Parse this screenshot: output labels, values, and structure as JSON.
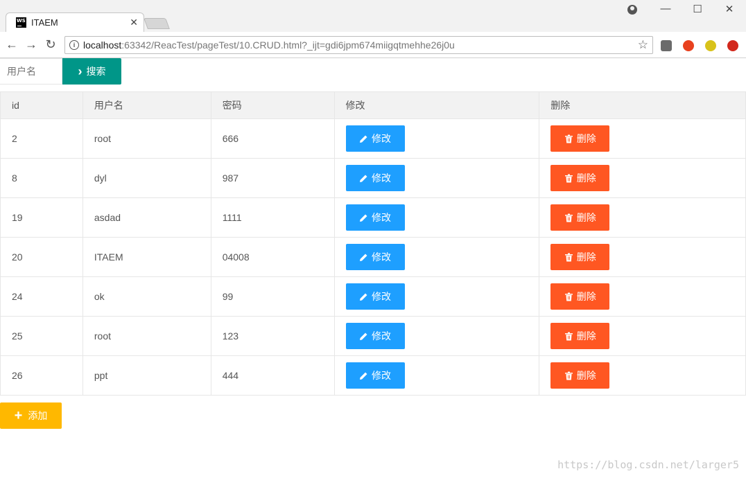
{
  "browser": {
    "tab_title": "ITAEM",
    "tab_close": "✕",
    "logo_text": "WS",
    "url_host": "localhost",
    "url_path": ":63342/ReacTest/pageTest/10.CRUD.html?_ijt=gdi6jpm674miigqtmehhe26j0u",
    "icons": [
      "back-icon",
      "forward-icon",
      "reload-icon",
      "info-icon",
      "star-icon",
      "minimize-icon",
      "maximize-icon",
      "close-icon"
    ]
  },
  "search": {
    "placeholder": "用户名",
    "button_label": "搜索"
  },
  "table": {
    "headers": [
      "id",
      "用户名",
      "密码",
      "修改",
      "删除"
    ],
    "edit_label": "修改",
    "delete_label": "删除",
    "rows": [
      {
        "id": "2",
        "username": "root",
        "password": "666"
      },
      {
        "id": "8",
        "username": "dyl",
        "password": "987"
      },
      {
        "id": "19",
        "username": "asdad",
        "password": "1111"
      },
      {
        "id": "20",
        "username": "ITAEM",
        "password": "04008"
      },
      {
        "id": "24",
        "username": "ok",
        "password": "99"
      },
      {
        "id": "25",
        "username": "root",
        "password": "123"
      },
      {
        "id": "26",
        "username": "ppt",
        "password": "444"
      }
    ]
  },
  "add_button_label": "添加",
  "watermark": "https://blog.csdn.net/larger5",
  "colors": {
    "search": "#009688",
    "edit": "#1e9fff",
    "delete": "#ff5722",
    "add": "#ffb800"
  }
}
